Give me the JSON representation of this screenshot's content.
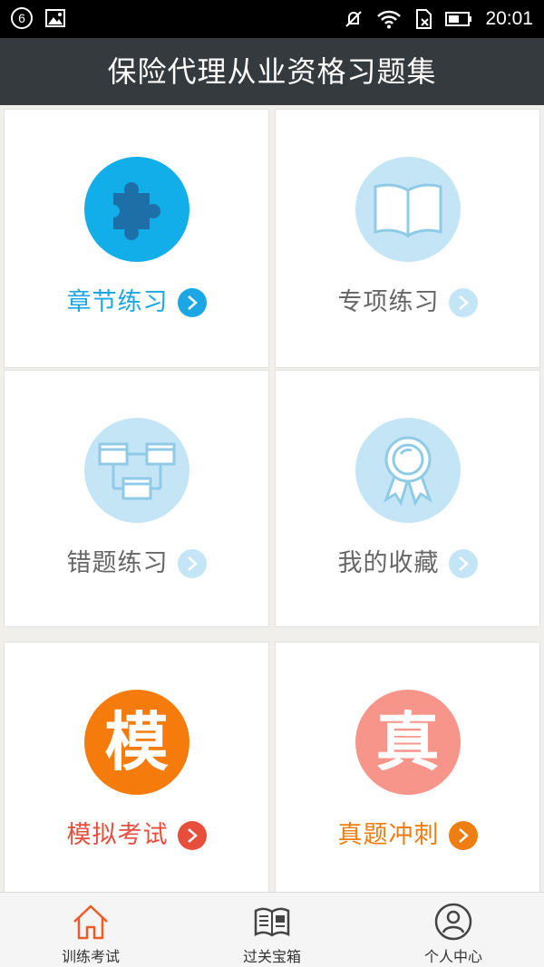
{
  "status_bar": {
    "notification_badge": "6",
    "time": "20:01"
  },
  "header": {
    "title": "保险代理从业资格习题集"
  },
  "grid": {
    "items": [
      {
        "label": "章节练习",
        "icon": "puzzle-icon",
        "label_color": "#1aa7e4",
        "circle_color": "#12aeea",
        "arrow_color": "#1aa7e4"
      },
      {
        "label": "专项练习",
        "icon": "book-icon",
        "label_color": "#666666",
        "circle_color": "#c3e5f5",
        "arrow_color": "#c3e5f5"
      },
      {
        "label": "错题练习",
        "icon": "flowchart-icon",
        "label_color": "#666666",
        "circle_color": "#c3e5f5",
        "arrow_color": "#c3e5f5"
      },
      {
        "label": "我的收藏",
        "icon": "ribbon-award-icon",
        "label_color": "#666666",
        "circle_color": "#c3e5f5",
        "arrow_color": "#c3e5f5"
      },
      {
        "label": "模拟考试",
        "icon": "mo-char-icon",
        "char": "模",
        "label_color": "#e84e3c",
        "circle_color": "#f57c0a",
        "arrow_color": "#e84e3c"
      },
      {
        "label": "真题冲刺",
        "icon": "zhen-char-icon",
        "char": "真",
        "label_color": "#f07d10",
        "circle_color": "#f8958a",
        "arrow_color": "#f07d10"
      }
    ]
  },
  "tab_bar": {
    "tabs": [
      {
        "label": "训练考试",
        "icon": "home-icon",
        "active": true,
        "color": "#f05a28"
      },
      {
        "label": "过关宝箱",
        "icon": "newspaper-icon",
        "active": false,
        "color": "#444444"
      },
      {
        "label": "个人中心",
        "icon": "user-icon",
        "active": false,
        "color": "#444444"
      }
    ]
  }
}
